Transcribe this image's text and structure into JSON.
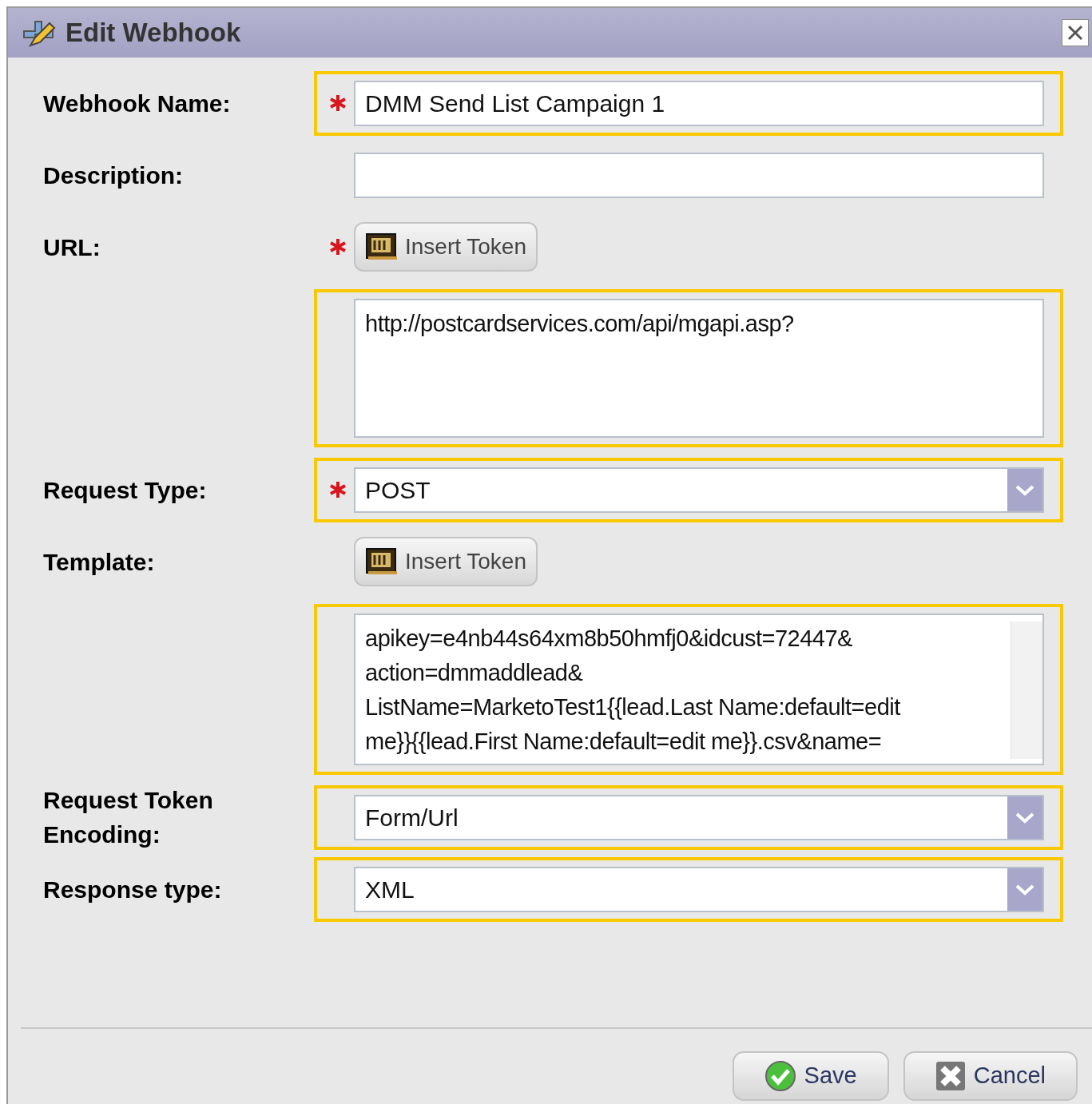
{
  "window": {
    "title": "Edit Webhook"
  },
  "rows": [
    {
      "kind": "input",
      "label": "Webhook Name:",
      "required": true,
      "highlighted": true,
      "value": "DMM Send List Campaign 1"
    },
    {
      "kind": "input",
      "label": "Description:",
      "required": false,
      "highlighted": false
    },
    {
      "kind": "token",
      "label": "URL:",
      "required": true,
      "highlighted": false,
      "button": "Insert Token"
    },
    {
      "kind": "textarea",
      "required": false,
      "highlighted": true,
      "lines": [
        "http://postcardservices.com/api/mgapi.asp?"
      ]
    },
    {
      "kind": "select",
      "label": "Request Type:",
      "required": true,
      "highlighted": true,
      "value": "POST"
    },
    {
      "kind": "token",
      "label": "Template:",
      "required": false,
      "highlighted": false,
      "button": "Insert Token"
    },
    {
      "kind": "textarea",
      "required": false,
      "highlighted": true,
      "scrollbar": true,
      "lines": [
        "apikey=e4nb44s64xm8b50hmfj0&idcust=72447&",
        "action=dmmaddlead&",
        "ListName=MarketoTest1{{lead.Last Name:default=edit",
        "me}}{{lead.First Name:default=edit me}}.csv&name="
      ]
    },
    {
      "kind": "select",
      "label": "Request Token Encoding:",
      "required": false,
      "highlighted": true,
      "value": "Form/Url"
    },
    {
      "kind": "select",
      "label": "Response type:",
      "required": false,
      "highlighted": true,
      "value": "XML"
    }
  ],
  "buttons": [
    {
      "kind": "save",
      "label": "Save"
    },
    {
      "kind": "cancel",
      "label": "Cancel"
    }
  ]
}
